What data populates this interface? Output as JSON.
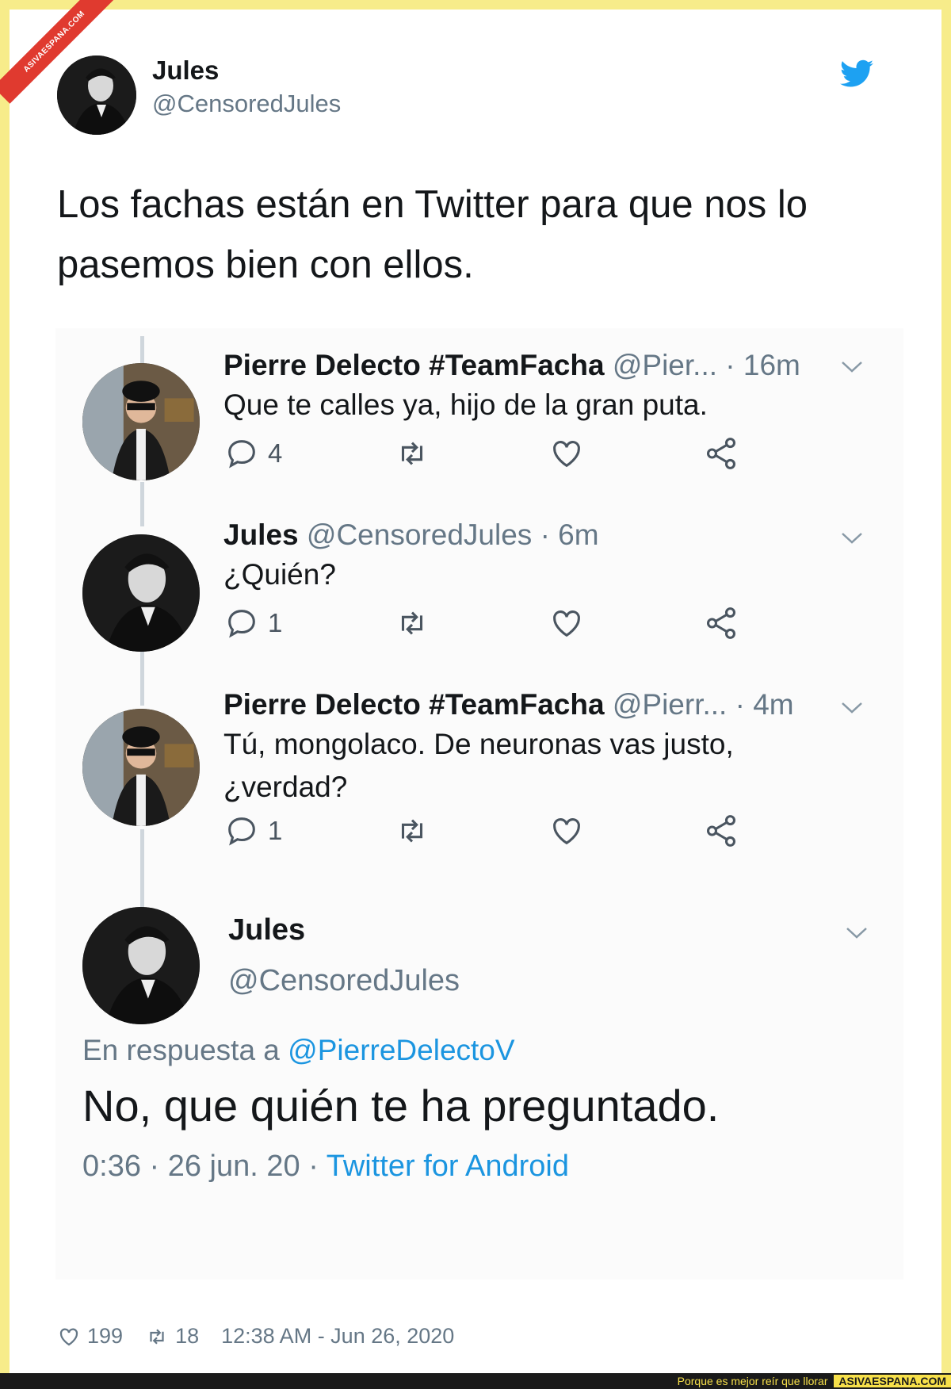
{
  "watermark": {
    "ribbon": "ASIVAESPANA.COM"
  },
  "tweet": {
    "author_name": "Jules",
    "author_handle": "@CensoredJules",
    "icon": "twitter-bird-icon",
    "text": "Los fachas están en Twitter para que nos lo pasemos bien con ellos."
  },
  "embed": {
    "thread": [
      {
        "name": "Pierre Delecto #TeamFacha",
        "handle": "@Pier...",
        "time": "· 16m",
        "text": "Que te calles ya, hijo de la gran puta.",
        "replies": "4"
      },
      {
        "name": "Jules",
        "handle": "@CensoredJules",
        "time": "· 6m",
        "text": "¿Quién?",
        "replies": "1"
      },
      {
        "name": "Pierre Delecto #TeamFacha",
        "handle": "@Pierr...",
        "time": "· 4m",
        "text": "Tú, mongolaco. De neuronas vas justo, ¿verdad?",
        "replies": "1"
      }
    ],
    "detail": {
      "name": "Jules",
      "handle": "@CensoredJules",
      "reply_prefix": "En respuesta a",
      "reply_mention": "@PierreDelectoV",
      "text": "No, que quién te ha preguntado.",
      "time": "0:36 · 26 jun. 20 ·",
      "source": "Twitter for Android"
    }
  },
  "footer": {
    "likes": "199",
    "retweets": "18",
    "timestamp": "12:38 AM - Jun 26, 2020"
  },
  "bottom_bar": {
    "tagline": "Porque es mejor reír que llorar",
    "site": "ASIVAESPANA.COM"
  },
  "colors": {
    "border": "#f7ec8a",
    "link": "#1b95e0",
    "secondary_text": "#657786"
  }
}
